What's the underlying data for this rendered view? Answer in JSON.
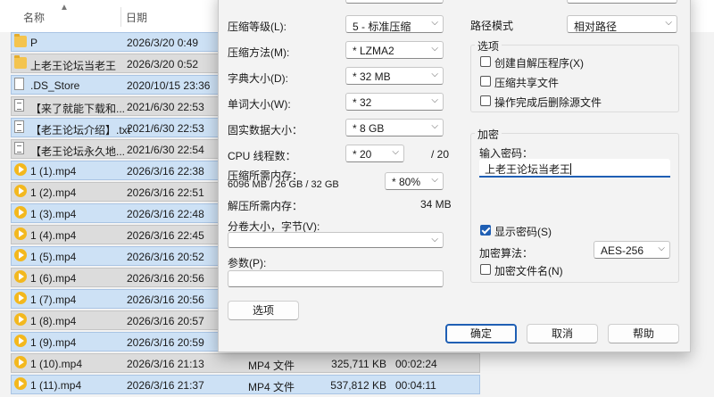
{
  "file_list": {
    "header": {
      "name": "名称",
      "date": "日期"
    },
    "rows": [
      {
        "icon": "folder-icon",
        "name": "P",
        "date": "2026/3/20 0:49",
        "type": "",
        "size": "",
        "duration": ""
      },
      {
        "icon": "folder-icon",
        "name": "上老王论坛当老王",
        "date": "2026/3/20 0:52",
        "type": "",
        "size": "",
        "duration": ""
      },
      {
        "icon": "file-icon",
        "name": ".DS_Store",
        "date": "2020/10/15 23:36",
        "type": "",
        "size": "",
        "duration": ""
      },
      {
        "icon": "text-file-icon",
        "name": "【来了就能下载和...",
        "date": "2021/6/30 22:53",
        "type": "",
        "size": "",
        "duration": ""
      },
      {
        "icon": "text-file-icon",
        "name": "【老王论坛介绍】.txt",
        "date": "2021/6/30 22:53",
        "type": "",
        "size": "",
        "duration": ""
      },
      {
        "icon": "text-file-icon",
        "name": "【老王论坛永久地...",
        "date": "2021/6/30 22:54",
        "type": "",
        "size": "",
        "duration": ""
      },
      {
        "icon": "video-file-icon",
        "name": "1 (1).mp4",
        "date": "2026/3/16 22:38",
        "type": "",
        "size": "",
        "duration": ""
      },
      {
        "icon": "video-file-icon",
        "name": "1 (2).mp4",
        "date": "2026/3/16 22:51",
        "type": "",
        "size": "",
        "duration": ""
      },
      {
        "icon": "video-file-icon",
        "name": "1 (3).mp4",
        "date": "2026/3/16 22:48",
        "type": "",
        "size": "",
        "duration": ""
      },
      {
        "icon": "video-file-icon",
        "name": "1 (4).mp4",
        "date": "2026/3/16 22:45",
        "type": "",
        "size": "",
        "duration": ""
      },
      {
        "icon": "video-file-icon",
        "name": "1 (5).mp4",
        "date": "2026/3/16 20:52",
        "type": "",
        "size": "",
        "duration": ""
      },
      {
        "icon": "video-file-icon",
        "name": "1 (6).mp4",
        "date": "2026/3/16 20:56",
        "type": "",
        "size": "",
        "duration": ""
      },
      {
        "icon": "video-file-icon",
        "name": "1 (7).mp4",
        "date": "2026/3/16 20:56",
        "type": "",
        "size": "",
        "duration": ""
      },
      {
        "icon": "video-file-icon",
        "name": "1 (8).mp4",
        "date": "2026/3/16 20:57",
        "type": "",
        "size": "",
        "duration": ""
      },
      {
        "icon": "video-file-icon",
        "name": "1 (9).mp4",
        "date": "2026/3/16 20:59",
        "type": "",
        "size": "",
        "duration": ""
      },
      {
        "icon": "video-file-icon",
        "name": "1 (10).mp4",
        "date": "2026/3/16 21:13",
        "type": "MP4 文件",
        "size": "325,711 KB",
        "duration": "00:02:24"
      },
      {
        "icon": "video-file-icon",
        "name": "1 (11).mp4",
        "date": "2026/3/16 21:37",
        "type": "MP4 文件",
        "size": "537,812 KB",
        "duration": "00:04:11"
      }
    ]
  },
  "dialog": {
    "compression_level": {
      "label": "压缩等级(L):",
      "value": "5 - 标准压缩"
    },
    "compression_method": {
      "label": "压缩方法(M):",
      "value": "* LZMA2"
    },
    "dictionary_size": {
      "label": "字典大小(D):",
      "value": "* 32 MB"
    },
    "word_size": {
      "label": "单词大小(W):",
      "value": "* 32"
    },
    "solid_block_size": {
      "label": "固实数据大小：",
      "value": "* 8 GB"
    },
    "cpu_threads": {
      "label": "CPU 线程数：",
      "value": "* 20",
      "max": "/ 20"
    },
    "memory_compress": {
      "label": "压缩所需内存：",
      "detail": "6096 MB / 26 GB / 32 GB",
      "value": "* 80%"
    },
    "memory_decompress": {
      "label": "解压所需内存：",
      "value": "34 MB"
    },
    "split_volumes": {
      "label": "分卷大小，字节(V):",
      "value": ""
    },
    "parameters": {
      "label": "参数(P):",
      "value": ""
    },
    "options_button": "选项",
    "path_mode": {
      "label": "路径模式",
      "value": "相对路径"
    },
    "options_group": {
      "title": "选项",
      "items": [
        {
          "label": "创建自解压程序(X)",
          "checked": false
        },
        {
          "label": "压缩共享文件",
          "checked": false
        },
        {
          "label": "操作完成后删除源文件",
          "checked": false
        }
      ]
    },
    "encryption_group": {
      "title": "加密",
      "password_label": "输入密码：",
      "password_value": "上老王论坛当老王",
      "show_password": {
        "label": "显示密码(S)",
        "checked": true
      },
      "method_label": "加密算法：",
      "method_value": "AES-256",
      "encrypt_names": {
        "label": "加密文件名(N)",
        "checked": false
      }
    },
    "buttons": {
      "ok": "确定",
      "cancel": "取消",
      "help": "帮助"
    }
  }
}
